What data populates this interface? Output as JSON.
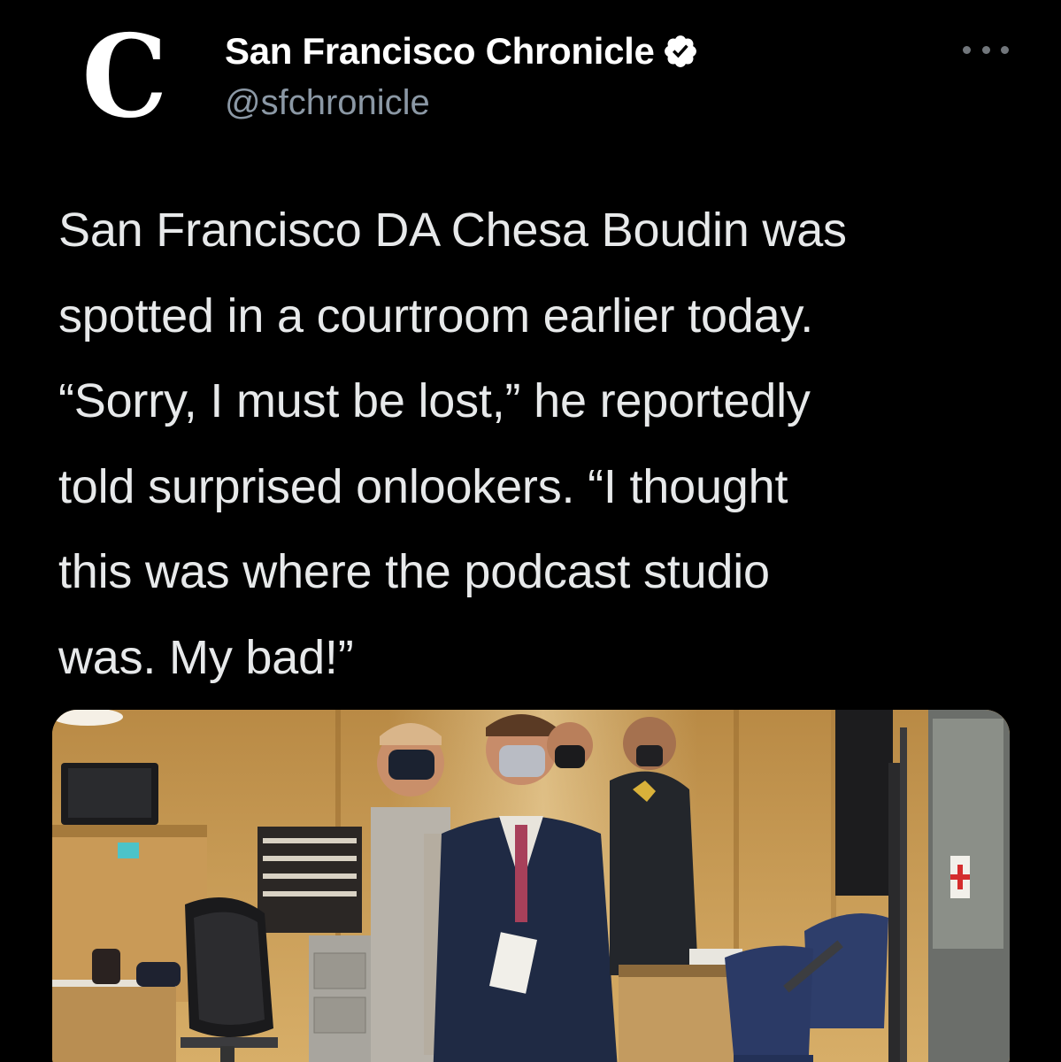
{
  "account": {
    "name": "San Francisco Chronicle",
    "handle": "@sfchronicle",
    "avatar_letter": "C",
    "verified_icon": "verified-badge-icon"
  },
  "menu": {
    "icon": "more-options-icon"
  },
  "tweet": {
    "lines": [
      "San Francisco DA Chesa Boudin was",
      "spotted in a courtroom earlier today.",
      "“Sorry, I must be lost,” he reportedly",
      "told surprised onlookers. “I thought",
      "this was where the podcast studio",
      "was. My bad!”"
    ]
  },
  "media": {
    "type": "photo",
    "scene": "courtroom"
  },
  "colors": {
    "background": "#000000",
    "text": "#e7e9ea",
    "secondary_text": "#8b98a5",
    "name": "#ffffff"
  }
}
